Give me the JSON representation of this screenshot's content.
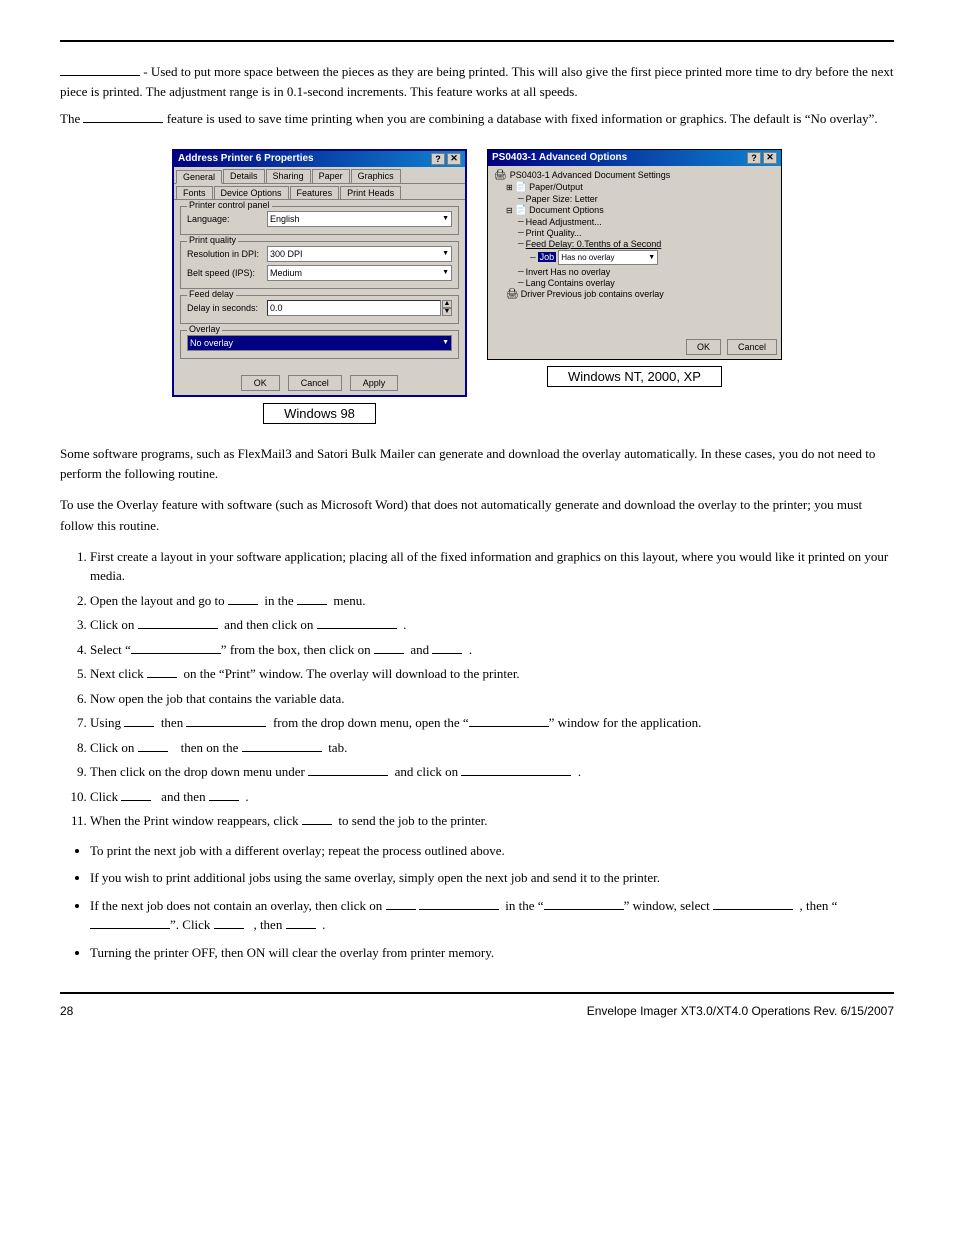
{
  "page": {
    "number": "28",
    "footer_title": "Envelope Imager XT3.0/XT4.0 Operations Rev. 6/15/2007"
  },
  "intro": {
    "para1": " - Used to put more space between the pieces as they are being printed.  This will also give the first piece printed more time to dry before the next piece is printed.  The adjustment range is in 0.1-second increments.  This feature works at all speeds.",
    "para2_prefix": "The",
    "para2_middle": "feature is used to save time printing when you are combining a database with fixed information or graphics.  The default is “No overlay”."
  },
  "screenshots": {
    "win98": {
      "title": "Address Printer 6 Properties",
      "caption": "Windows 98",
      "tabs": [
        "General",
        "Details",
        "Sharing",
        "Paper",
        "Graphics",
        "Fonts",
        "Device Options",
        "Features",
        "Print Heads"
      ],
      "group1_label": "Printer control panel",
      "language_label": "Language:",
      "language_value": "English",
      "group2_label": "Print quality",
      "resolution_label": "Resolution in DPI:",
      "resolution_value": "300 DPI",
      "belt_label": "Belt speed (IPS):",
      "belt_value": "Medium",
      "group3_label": "Feed delay",
      "delay_label": "Delay in seconds:",
      "delay_value": "0.0",
      "group4_label": "Overlay",
      "overlay_value": "No overlay",
      "btn_ok": "OK",
      "btn_cancel": "Cancel",
      "btn_apply": "Apply"
    },
    "winnt": {
      "title": "PS0403-1 Advanced Options",
      "caption": "Windows NT, 2000, XP",
      "tree": {
        "root": "PS0403-1 Advanced Document Settings",
        "paper_output": "Paper/Output",
        "paper_size": "Paper Size: Letter",
        "document_options": "Document Options",
        "head_adjust": "Head Adjustment...",
        "print_quality": "Print Quality...",
        "feed_delay": "Feed Delay: 0.Tenths of a Second",
        "overlay_label": "Job",
        "overlay_value": "Has no overlay",
        "invert_label": "Invert",
        "invert_value": "Has no overlay",
        "lang_label": "Lang",
        "lang_value": "Contains overlay",
        "driver_label": "Driver",
        "driver_value": "Previous job contains overlay"
      },
      "btn_ok": "OK",
      "btn_cancel": "Cancel"
    }
  },
  "body": {
    "para1": "Some software programs, such as FlexMail3 and Satori Bulk Mailer can generate and download the overlay automatically. In these cases, you do not need to perform the following routine.",
    "para2": "To use the Overlay feature with software (such as Microsoft Word) that does not automatically generate and download the overlay to the printer; you must follow this routine.",
    "steps": [
      "First create a layout in your software application; placing all of the fixed information and graphics on this layout, where you would like it printed on your media.",
      "Open the layout and go to ___  in the ___  menu.",
      "Click on            and then click on           .",
      "Select “                    ” from the box, then click on ___  and     .",
      "Next click      on the “Print” window.  The overlay will download to the printer.",
      "Now open the job that contains the variable data.",
      "Using ___  then ___       from the drop down menu, open the “        ” window for the application.",
      "Click on ___         then on the           tab.",
      "Then click on the drop down menu under           and click on                     .",
      "Click ___       and then      .",
      "When the Print window reappears, click       to send the job to the printer."
    ],
    "bullets": [
      "To print the next job with a different overlay; repeat the process outlined above.",
      "If you wish to print additional jobs using the same overlay, simply open the next job and send it to the printer.",
      "If the next job does not contain an overlay, then click on ___              in the “        ” window, select              , then “                    . Click ___      , then       .",
      "Turning the printer OFF, then ON will clear the overlay from printer memory."
    ]
  }
}
